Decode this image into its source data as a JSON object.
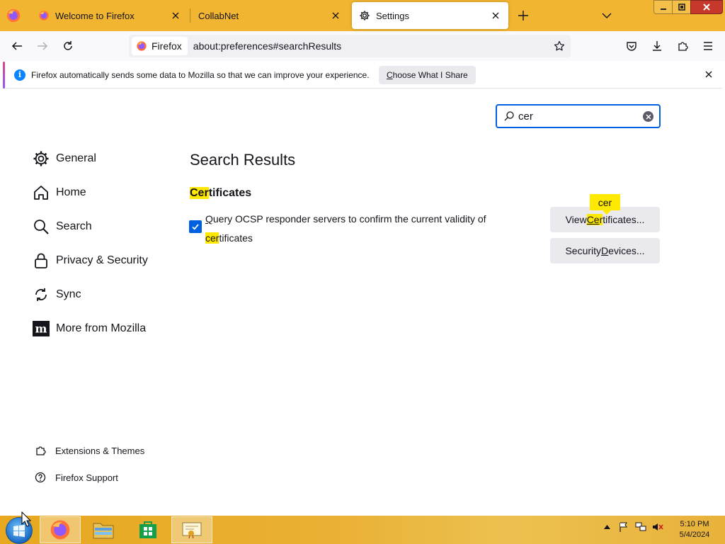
{
  "browser": {
    "tabs": [
      {
        "label": "Welcome to Firefox",
        "favicon": "firefox-icon",
        "active": false
      },
      {
        "label": "CollabNet",
        "favicon": "",
        "active": false
      },
      {
        "label": "Settings",
        "favicon": "gear-icon",
        "active": true
      }
    ],
    "identity_label": "Firefox",
    "url": "about:preferences#searchResults",
    "colors": {
      "titlebar": "#f2b531",
      "accent": "#0061e0",
      "highlight": "#ffe900",
      "close": "#c7382c"
    }
  },
  "notification": {
    "message": "Firefox automatically sends some data to Mozilla so that we can improve your experience.",
    "button_label": "Choose What I Share",
    "button_accesskey": "C",
    "button_rest": "hoose What I Share"
  },
  "settings": {
    "search_value": "cer",
    "sidebar": [
      {
        "label": "General",
        "icon": "gear-icon"
      },
      {
        "label": "Home",
        "icon": "home-icon"
      },
      {
        "label": "Search",
        "icon": "search-icon"
      },
      {
        "label": "Privacy & Security",
        "icon": "lock-icon"
      },
      {
        "label": "Sync",
        "icon": "sync-icon"
      },
      {
        "label": "More from Mozilla",
        "icon": "mozilla-icon"
      }
    ],
    "footer": [
      {
        "label": "Extensions & Themes",
        "icon": "puzzle-icon"
      },
      {
        "label": "Firefox Support",
        "icon": "help-icon"
      }
    ],
    "results_title": "Search Results",
    "section": {
      "hl": "Cer",
      "rest": "tificates"
    },
    "ocsp": {
      "first": "Q",
      "line1_rest": "uery OCSP responder servers to confirm the current validity of",
      "hl": "cer",
      "line2_rest": "tificates",
      "checked": true
    },
    "view_btn": {
      "pre": "View ",
      "hl": "Ce",
      "hl2": "r",
      "rest": "tificates..."
    },
    "sec_btn": {
      "pre": "Security ",
      "accesskey": "D",
      "rest": "evices..."
    },
    "tooltip": "cer"
  },
  "taskbar": {
    "time": "5:10 PM",
    "date": "5/4/2024"
  }
}
